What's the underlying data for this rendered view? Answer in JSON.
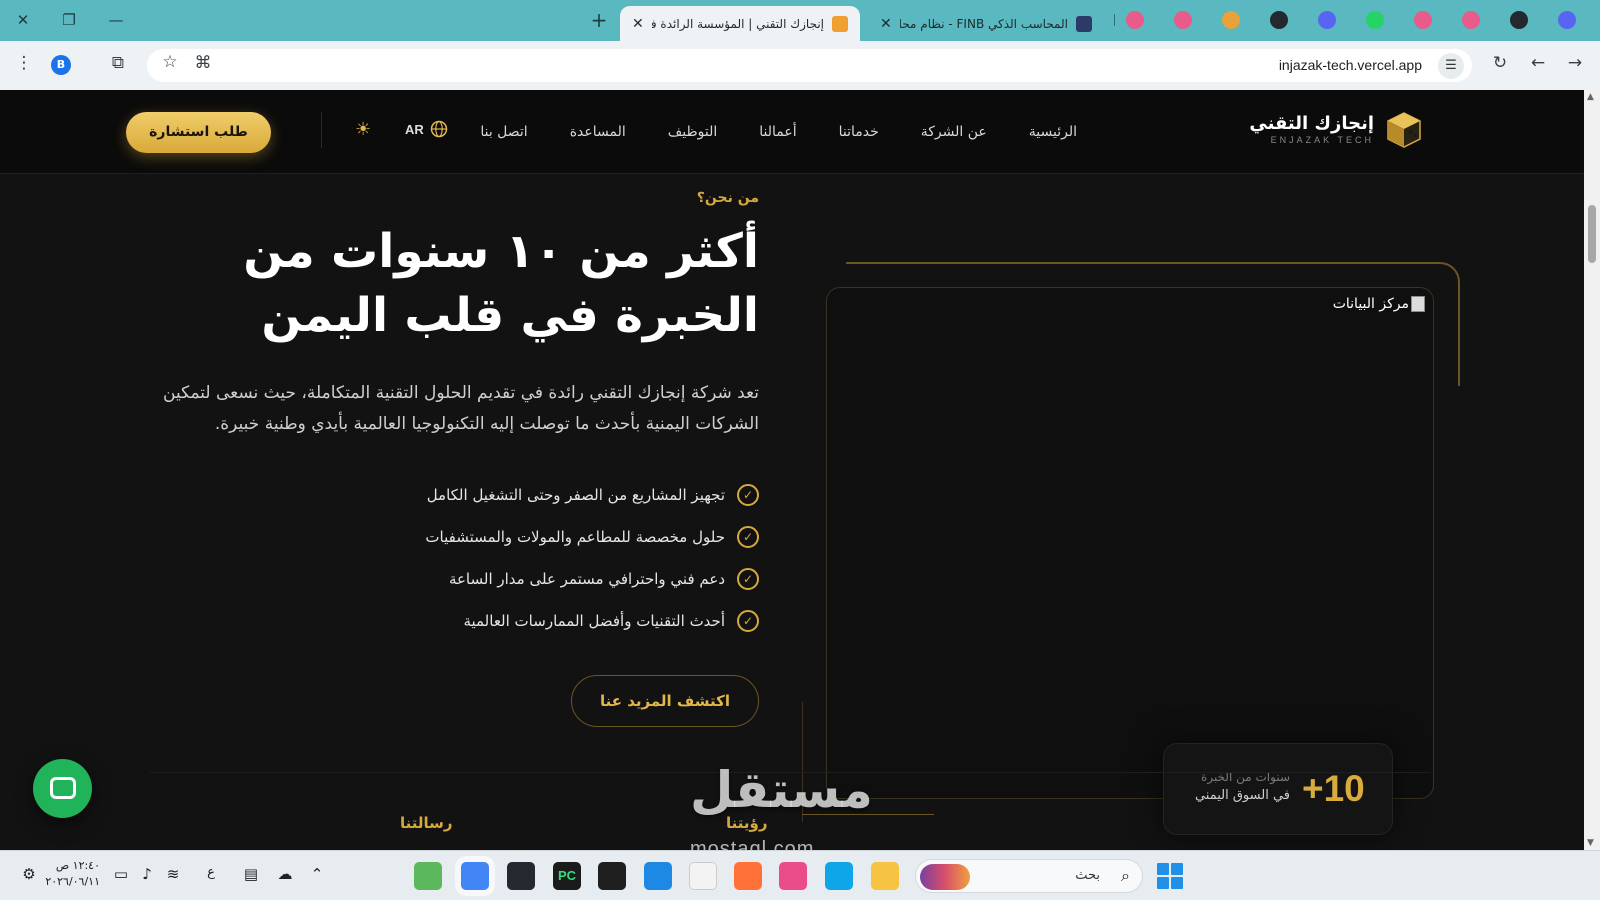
{
  "browser": {
    "tabs": [
      {
        "title": "إنجازك التقني | المؤسسة الرائدة في",
        "active": true,
        "favicon_color": "#f0a030"
      },
      {
        "title": "المحاسب الذكي FINB - نظام محاسبة",
        "active": false,
        "favicon_color": "#2b3a67"
      }
    ],
    "pinned_tab_icons": [
      "figma-icon",
      "figma-icon",
      "slack-icon",
      "github-icon",
      "discord-icon",
      "whatsapp-icon",
      "figma-icon",
      "figma-icon",
      "github-icon",
      "discord-icon",
      "whatsapp-icon"
    ],
    "pinned_tab_colors": [
      "#e85b8a",
      "#e85b8a",
      "#e9a23b",
      "#24292f",
      "#5865f2",
      "#25d366",
      "#e85b8a",
      "#e85b8a",
      "#24292f",
      "#5865f2",
      "#25d366"
    ],
    "url": "injazak-tech.vercel.app",
    "profile_initial": "B"
  },
  "site": {
    "logo_ar": "إنجازك التقني",
    "logo_en": "ENJAZAK TECH",
    "nav": [
      "الرئيسية",
      "عن الشركة",
      "خدماتنا",
      "أعمالنا",
      "التوظيف",
      "المساعدة",
      "اتصل بنا"
    ],
    "lang": "AR",
    "cta": "طلب استشارة",
    "accent": "#d6a93c"
  },
  "hero": {
    "eyebrow": "من نحن؟",
    "title": "أكثر من ١٠ سنوات من الخبرة في قلب اليمن",
    "description": "تعد شركة إنجازك التقني رائدة في تقديم الحلول التقنية المتكاملة، حيث نسعى لتمكين الشركات اليمنية بأحدث ما توصلت إليه التكنولوجيا العالمية بأيدي وطنية خبيرة.",
    "features": [
      "تجهيز المشاريع من الصفر وحتى التشغيل الكامل",
      "حلول مخصصة للمطاعم والمولات والمستشفيات",
      "دعم فني واحترافي مستمر على مدار الساعة",
      "أحدث التقنيات وأفضل الممارسات العالمية"
    ],
    "more_button": "اكتشف المزيد عنا"
  },
  "image_panel": {
    "alt": "مركز البيانات"
  },
  "stat": {
    "number": "+10",
    "label_1": "سنوات من الخبرة",
    "label_2": "في السوق اليمني"
  },
  "sections": {
    "vision": "رؤيتنا",
    "mission": "رسالتنا"
  },
  "watermark": {
    "ar": "مستقل",
    "en": "mostaql.com"
  },
  "taskbar": {
    "time": "١٢:٤٠ ص",
    "date": "٢٠٢٦/٠٦/١١",
    "lang_indicator": "ع",
    "search_placeholder": "بحث",
    "pycharm_label": "PC"
  }
}
